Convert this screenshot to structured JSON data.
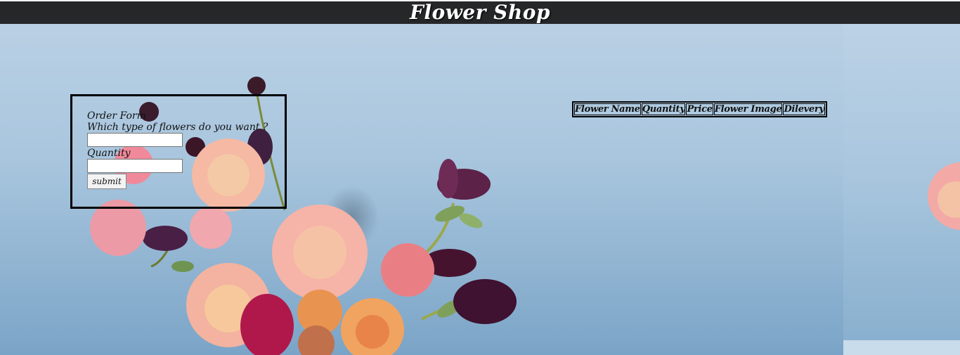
{
  "header": {
    "title": "Flower Shop"
  },
  "form": {
    "title": "Order Form",
    "flower_type_label": "Which type of flowers do you want ?",
    "flower_type_value": "",
    "quantity_label": "Quantity",
    "quantity_value": "",
    "submit_label": "submit"
  },
  "table": {
    "headers": [
      "Flower Name",
      "Quantity",
      "Price",
      "Flower Image",
      "Dilevery"
    ]
  },
  "colors": {
    "header_bg": "#262729",
    "sky": "#a9c6de",
    "border": "#000000"
  }
}
